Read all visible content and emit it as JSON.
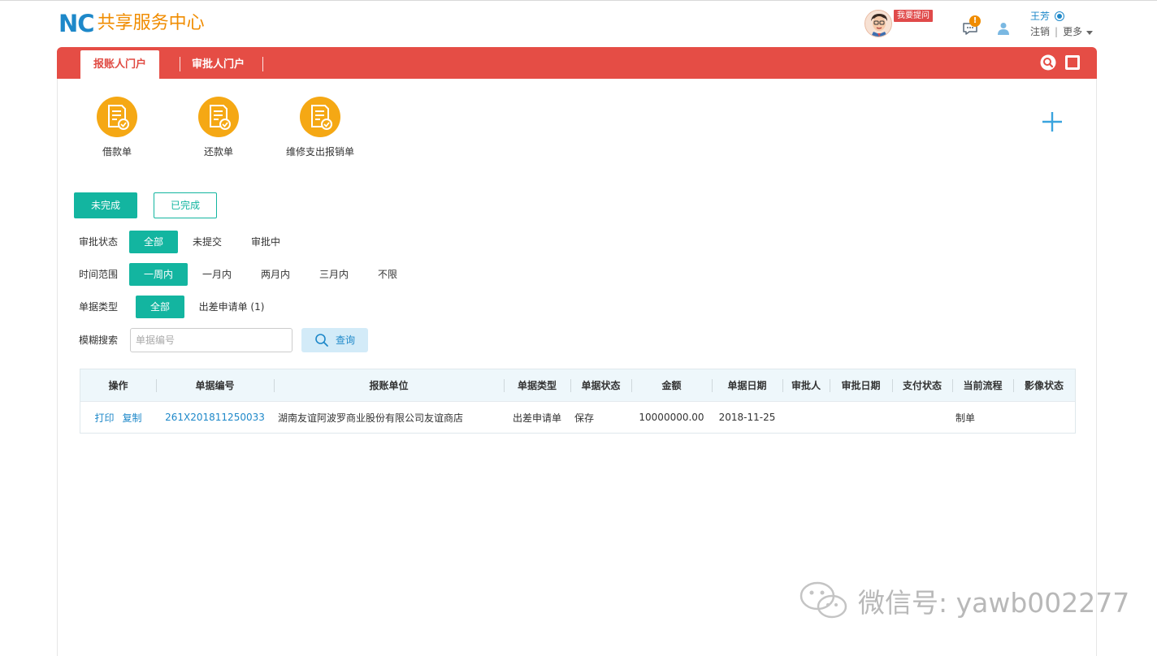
{
  "header": {
    "logo_mark": "NC",
    "logo_text": "共享服务中心",
    "ask_badge": "我要提问",
    "message_count": "!",
    "user_name": "王芳",
    "logout_label": "注销",
    "more_label": "更多"
  },
  "nav": {
    "tabs": [
      {
        "label": "报账人门户",
        "active": true
      },
      {
        "label": "审批人门户",
        "active": false
      }
    ]
  },
  "quick_actions": [
    {
      "label": "借款单",
      "icon": "document-check-icon"
    },
    {
      "label": "还款单",
      "icon": "document-check-icon"
    },
    {
      "label": "维修支出报销单",
      "icon": "document-check-icon"
    }
  ],
  "status_tabs": {
    "incomplete": "未完成",
    "complete": "已完成"
  },
  "filters": {
    "approval_status": {
      "label": "审批状态",
      "options": [
        "全部",
        "未提交",
        "审批中"
      ],
      "selected": "全部"
    },
    "time_range": {
      "label": "时间范围",
      "options": [
        "一周内",
        "一月内",
        "两月内",
        "三月内",
        "不限"
      ],
      "selected": "一周内"
    },
    "doc_type": {
      "label": "单据类型",
      "options": [
        "全部",
        "出差申请单 (1)"
      ],
      "selected": "全部"
    },
    "fuzzy_search": {
      "label": "模糊搜索",
      "placeholder": "单据编号",
      "value": "",
      "button": "查询"
    }
  },
  "table": {
    "columns": [
      "操作",
      "单据编号",
      "报账单位",
      "单据类型",
      "单据状态",
      "金额",
      "单据日期",
      "审批人",
      "审批日期",
      "支付状态",
      "当前流程",
      "影像状态"
    ],
    "rows": [
      {
        "actions": [
          "打印",
          "复制"
        ],
        "doc_no": "261X201811250033",
        "unit": "湖南友谊阿波罗商业股份有限公司友谊商店",
        "doc_type": "出差申请单",
        "status": "保存",
        "amount": "10000000.00",
        "date": "2018-11-25",
        "approver": "",
        "approve_date": "",
        "pay_status": "",
        "flow": "制单",
        "image_status": ""
      }
    ]
  },
  "watermark": "微信号: yawb002277",
  "colors": {
    "brand_blue": "#1e88c9",
    "brand_orange": "#f08c00",
    "nav_red": "#e54d45",
    "teal": "#13b5a0",
    "icon_yellow": "#f5a814"
  }
}
